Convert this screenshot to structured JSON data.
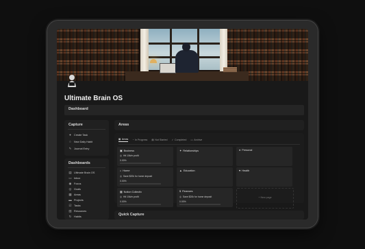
{
  "page": {
    "title": "Ultimate Brain OS"
  },
  "dashboard_bar": {
    "label": "Dashboard"
  },
  "capture": {
    "title": "Capture",
    "items": [
      {
        "label": "Create Task",
        "icon": "check-circle-icon"
      },
      {
        "label": "New Daily Habit",
        "icon": "radio-circle-icon"
      },
      {
        "label": "Journal Entry",
        "icon": "pen-icon"
      }
    ]
  },
  "dashboards": {
    "title": "Dashboards",
    "items": [
      {
        "label": "Ultimate Brain OS",
        "icon": "page-icon"
      },
      {
        "label": "Inbox",
        "icon": "inbox-icon"
      },
      {
        "label": "Focus",
        "icon": "focus-icon"
      },
      {
        "label": "Goals",
        "icon": "goal-icon"
      },
      {
        "label": "Areas",
        "icon": "areas-icon"
      },
      {
        "label": "Projects",
        "icon": "folder-icon"
      },
      {
        "label": "Tasks",
        "icon": "tasks-icon"
      },
      {
        "label": "Resources",
        "icon": "resources-icon"
      },
      {
        "label": "Habits",
        "icon": "habits-icon"
      }
    ]
  },
  "areas": {
    "title": "Areas",
    "tabs": [
      {
        "label": "Areas",
        "active": true
      },
      {
        "label": "In Progress",
        "active": false
      },
      {
        "label": "Not Started",
        "active": false
      },
      {
        "label": "Completed",
        "active": false
      },
      {
        "label": "Archive",
        "active": false
      }
    ],
    "cards": [
      {
        "name": "Business",
        "goal": "Hit 10k/m profit",
        "percent": "0.00%"
      },
      {
        "name": "Relationships",
        "goal": "",
        "percent": ""
      },
      {
        "name": "Personal",
        "goal": "",
        "percent": ""
      },
      {
        "name": "Home",
        "goal": "Save $20k for home deposit",
        "percent": "0.00%"
      },
      {
        "name": "Education",
        "goal": "",
        "percent": ""
      },
      {
        "name": "Health",
        "goal": "",
        "percent": ""
      },
      {
        "name": "Notion Collectiv",
        "goal": "Hit 10k/m profit",
        "percent": "0.00%"
      },
      {
        "name": "Finances",
        "goal": "Save $20k for home deposit",
        "percent": "0.00%"
      }
    ],
    "new_page_label": "+ New page"
  },
  "quick_capture": {
    "title": "Quick Capture"
  }
}
